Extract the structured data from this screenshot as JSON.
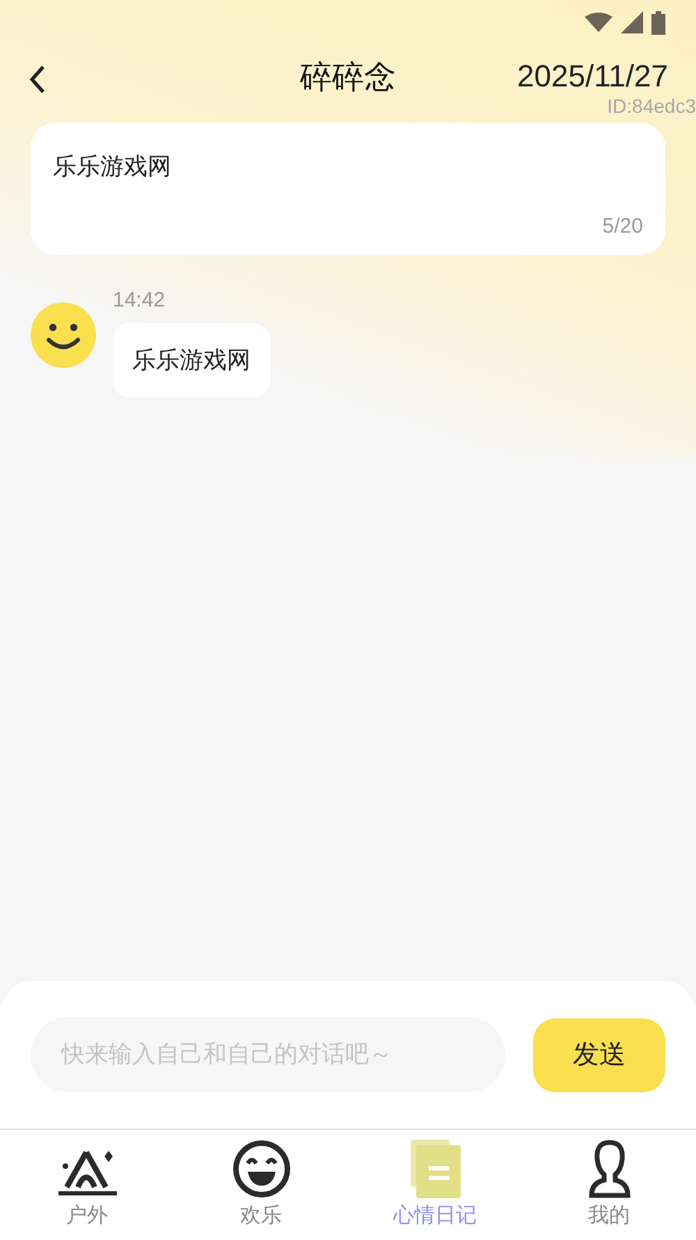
{
  "header": {
    "title": "碎碎念",
    "date": "2025/11/27",
    "id_label": "ID:84edc3"
  },
  "note_card": {
    "text": "乐乐游戏网",
    "counter": "5/20"
  },
  "messages": [
    {
      "time": "14:42",
      "text": "乐乐游戏网"
    }
  ],
  "composer": {
    "placeholder": "快来输入自己和自己的对话吧～",
    "send": "发送"
  },
  "tabs": [
    {
      "label": "户外",
      "kind": "tent",
      "selected": false
    },
    {
      "label": "欢乐",
      "kind": "smile",
      "selected": false
    },
    {
      "label": "心情日记",
      "kind": "notes",
      "selected": true
    },
    {
      "label": "我的",
      "kind": "person",
      "selected": false
    }
  ]
}
